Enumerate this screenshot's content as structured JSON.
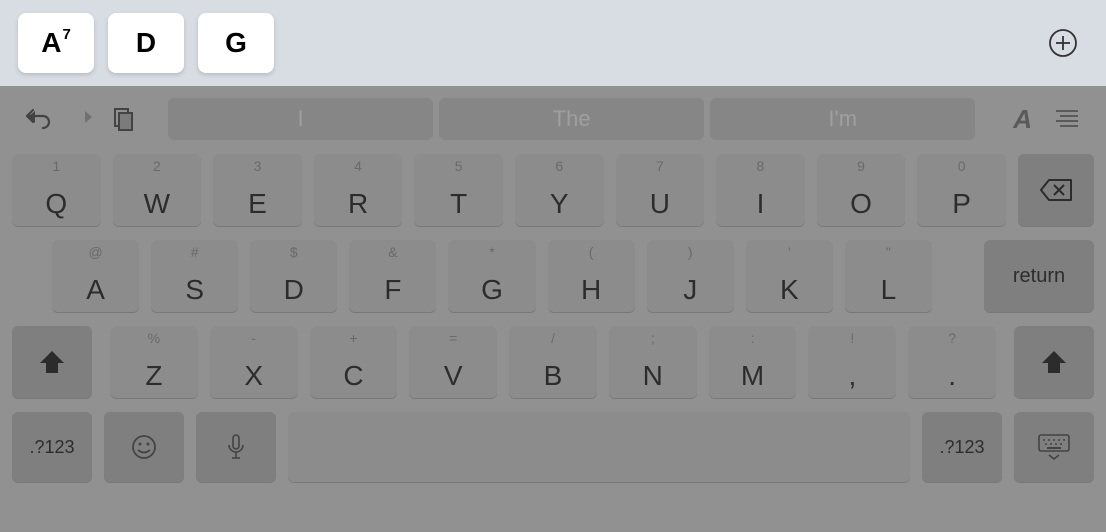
{
  "chords": [
    {
      "main": "A",
      "sup": "7"
    },
    {
      "main": "D",
      "sup": ""
    },
    {
      "main": "G",
      "sup": ""
    }
  ],
  "suggestions": [
    "I",
    "The",
    "I'm"
  ],
  "format_letter": "A",
  "row1": [
    {
      "m": "Q",
      "s": "1"
    },
    {
      "m": "W",
      "s": "2"
    },
    {
      "m": "E",
      "s": "3"
    },
    {
      "m": "R",
      "s": "4"
    },
    {
      "m": "T",
      "s": "5"
    },
    {
      "m": "Y",
      "s": "6"
    },
    {
      "m": "U",
      "s": "7"
    },
    {
      "m": "I",
      "s": "8"
    },
    {
      "m": "O",
      "s": "9"
    },
    {
      "m": "P",
      "s": "0"
    }
  ],
  "row2": [
    {
      "m": "A",
      "s": "@"
    },
    {
      "m": "S",
      "s": "#"
    },
    {
      "m": "D",
      "s": "$"
    },
    {
      "m": "F",
      "s": "&"
    },
    {
      "m": "G",
      "s": "*"
    },
    {
      "m": "H",
      "s": "("
    },
    {
      "m": "J",
      "s": ")"
    },
    {
      "m": "K",
      "s": "'"
    },
    {
      "m": "L",
      "s": "\""
    }
  ],
  "row3": [
    {
      "m": "Z",
      "s": "%"
    },
    {
      "m": "X",
      "s": "-"
    },
    {
      "m": "C",
      "s": "+"
    },
    {
      "m": "V",
      "s": "="
    },
    {
      "m": "B",
      "s": "/"
    },
    {
      "m": "N",
      "s": ";"
    },
    {
      "m": "M",
      "s": ":"
    },
    {
      "m": ",",
      "s": "!"
    },
    {
      "m": ".",
      "s": "?"
    }
  ],
  "return_label": "return",
  "num_label": ".?123"
}
